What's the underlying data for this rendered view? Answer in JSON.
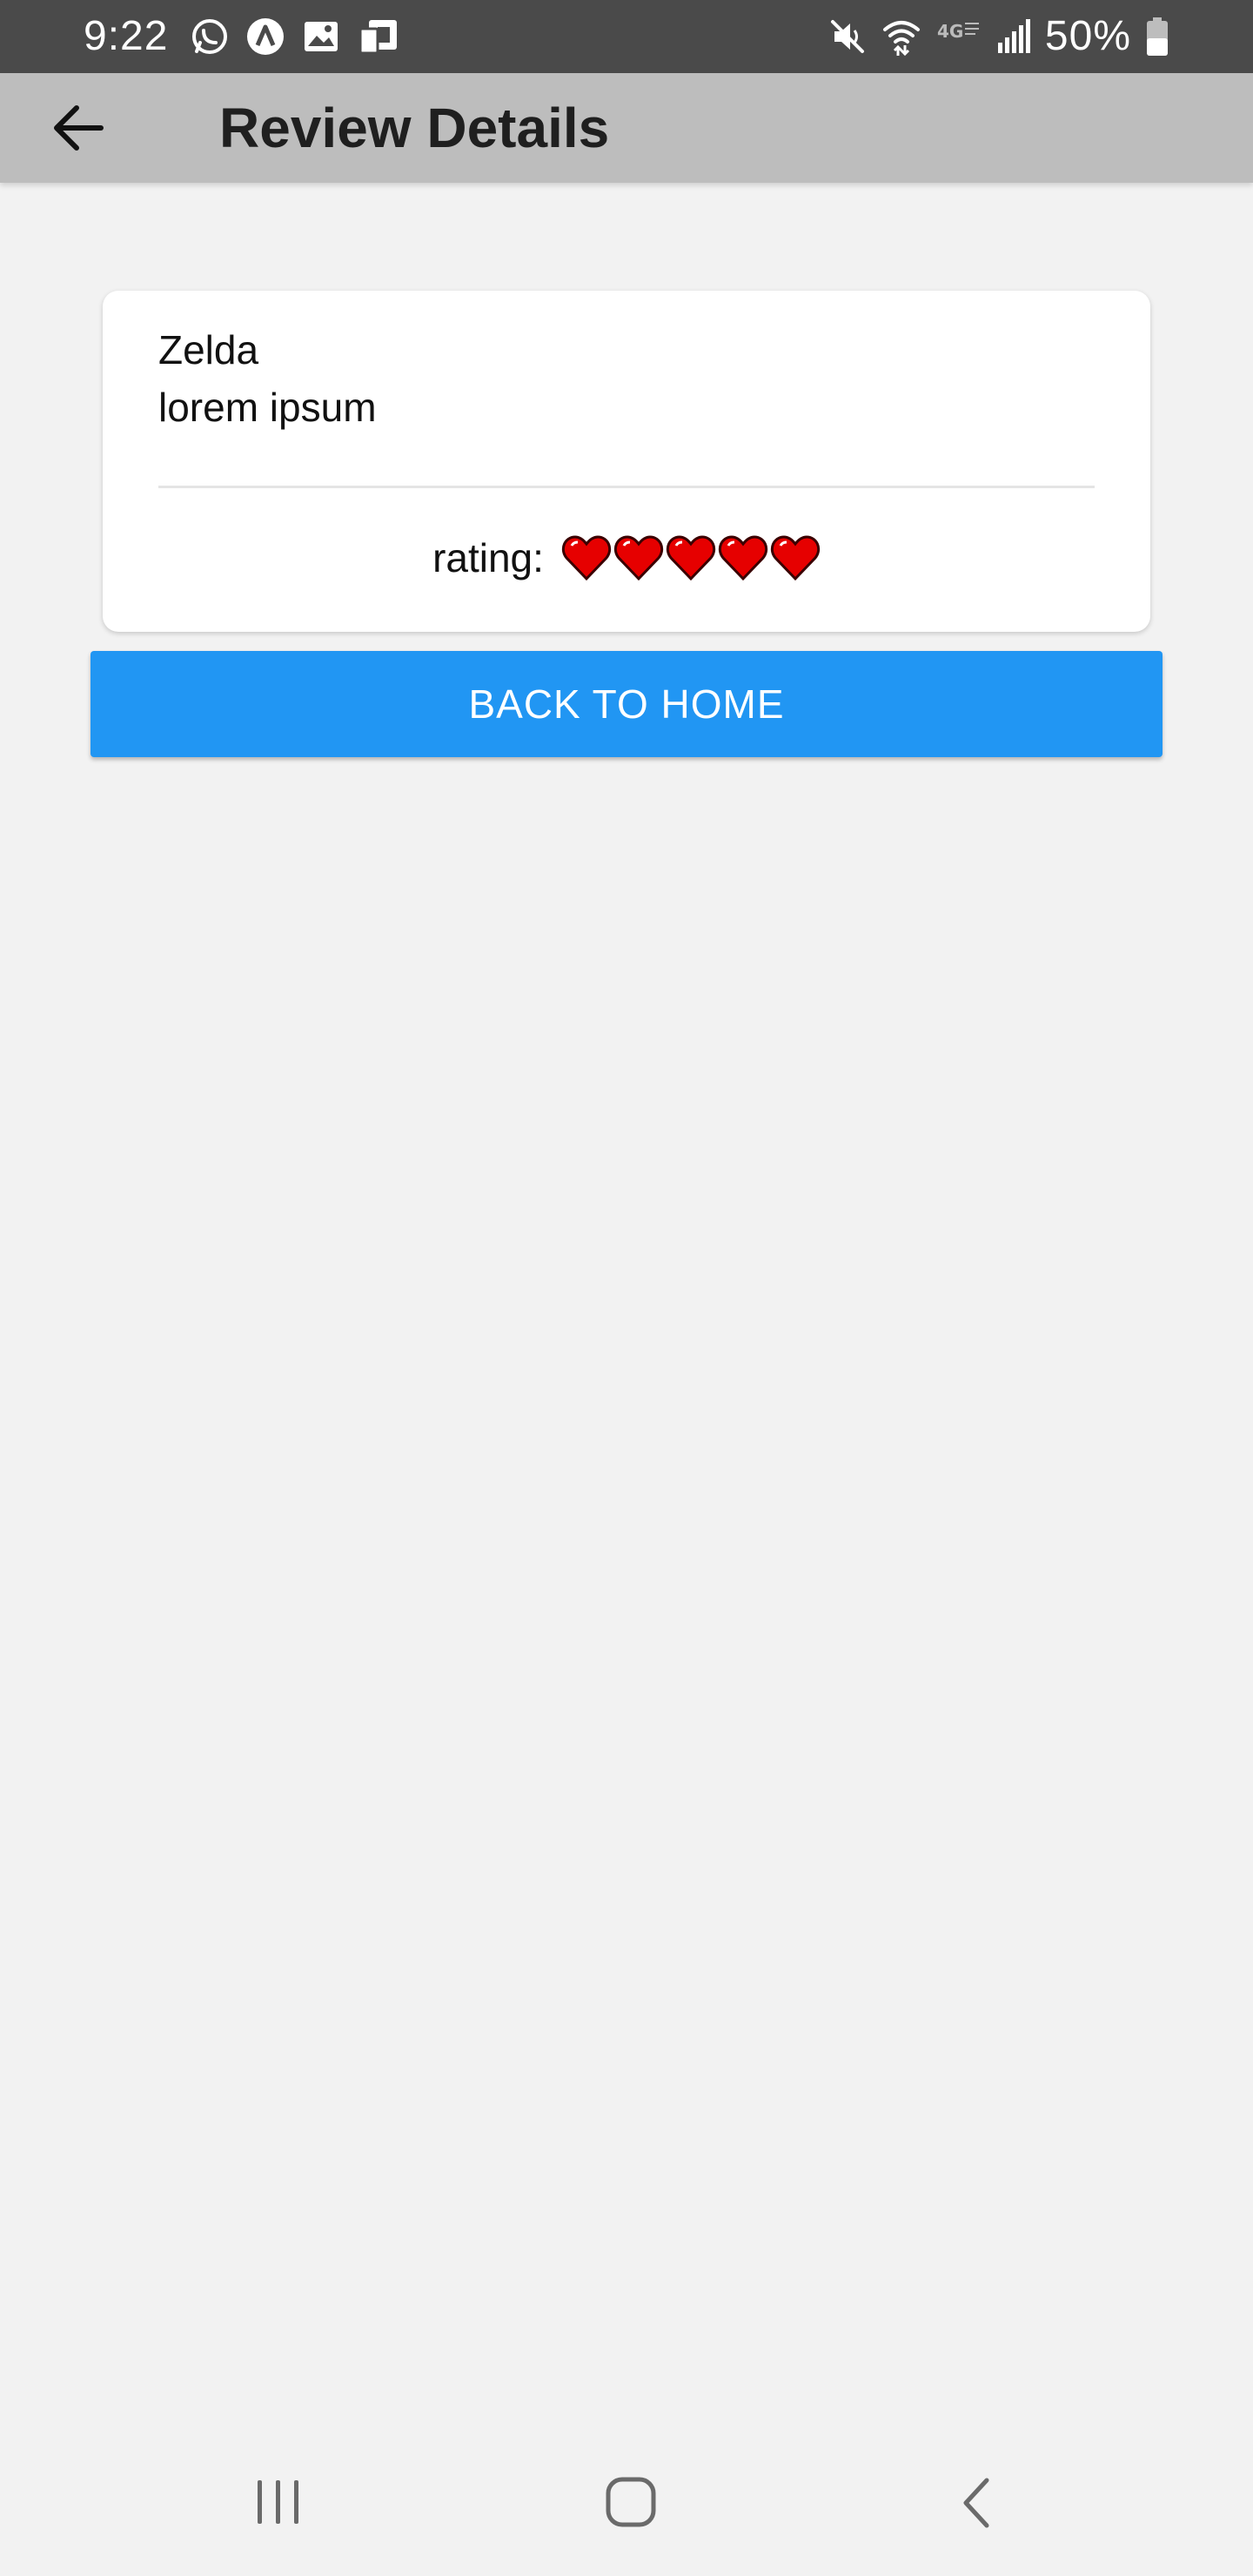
{
  "status_bar": {
    "time": "9:22",
    "battery_text": "50%",
    "left_icons": [
      "whatsapp-icon",
      "arrow-app-icon",
      "gallery-icon",
      "device-icon"
    ],
    "right_icons": [
      "mute-icon",
      "wifi-icon",
      "lte-icon",
      "signal-icon",
      "battery-icon"
    ]
  },
  "app_bar": {
    "title": "Review Details",
    "back_icon": "back-arrow-icon"
  },
  "review": {
    "title": "Zelda",
    "body": "lorem ipsum",
    "rating_label": "rating:",
    "rating": 5,
    "rating_max": 5
  },
  "actions": {
    "back_home_label": "BACK TO HOME"
  },
  "nav_bar": {
    "items": [
      "recent-apps-icon",
      "home-icon",
      "back-icon"
    ]
  },
  "colors": {
    "status_bar": "#4a4a4a",
    "app_bar": "#bdbdbd",
    "background": "#f2f2f2",
    "primary_button": "#2196f3",
    "heart": "#e60000"
  }
}
